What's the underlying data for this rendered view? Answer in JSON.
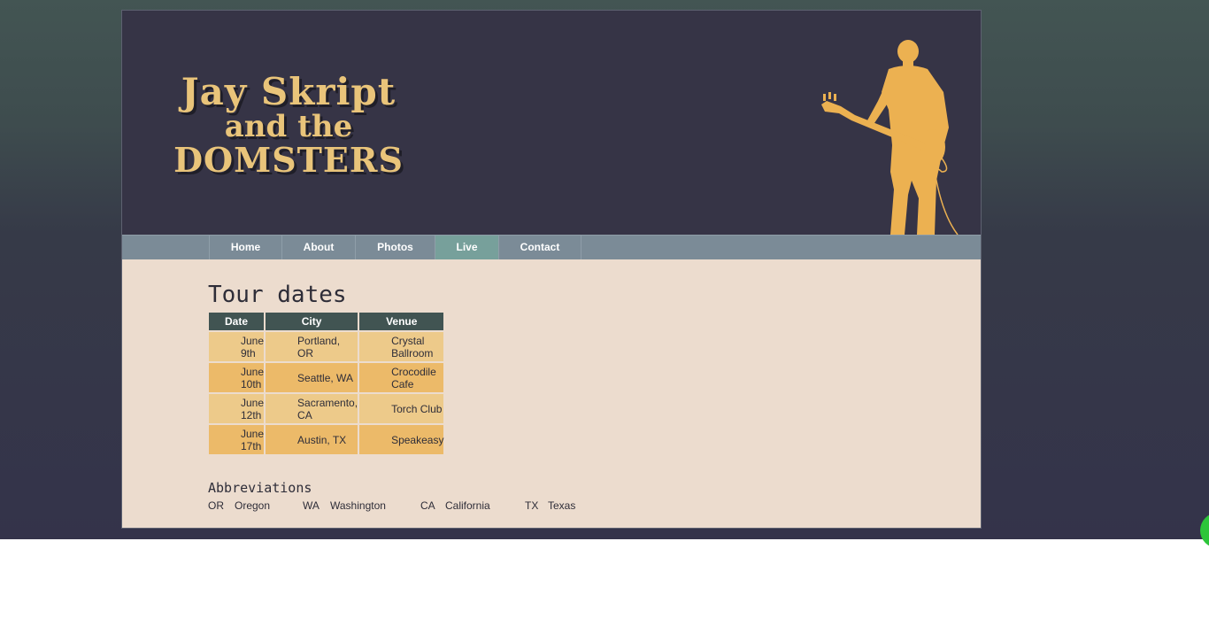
{
  "logo": {
    "line1": "Jay Skript",
    "line2": "and the",
    "line3": "DOMSTERS"
  },
  "nav": {
    "items": [
      {
        "label": "Home"
      },
      {
        "label": "About"
      },
      {
        "label": "Photos"
      },
      {
        "label": "Live",
        "active": true
      },
      {
        "label": "Contact"
      }
    ]
  },
  "main": {
    "title": "Tour dates",
    "table": {
      "headers": [
        "Date",
        "City",
        "Venue"
      ],
      "rows": [
        [
          "June 9th",
          "Portland, OR",
          "Crystal Ballroom"
        ],
        [
          "June 10th",
          "Seattle, WA",
          "Crocodile Cafe"
        ],
        [
          "June 12th",
          "Sacramento, CA",
          "Torch Club"
        ],
        [
          "June 17th",
          "Austin, TX",
          "Speakeasy"
        ]
      ]
    },
    "abbreviations": {
      "title": "Abbreviations",
      "items": [
        {
          "abbr": "OR",
          "name": "Oregon"
        },
        {
          "abbr": "WA",
          "name": "Washington"
        },
        {
          "abbr": "CA",
          "name": "California"
        },
        {
          "abbr": "TX",
          "name": "Texas"
        }
      ]
    }
  },
  "colors": {
    "header_bg": "#363446",
    "accent": "#ecb151",
    "nav_bg": "#7b8b97",
    "nav_active": "#77a09b",
    "table_header": "#415452",
    "content_bg": "#ecdcce"
  },
  "icons": {
    "guitarist": "guitarist-silhouette-icon"
  }
}
